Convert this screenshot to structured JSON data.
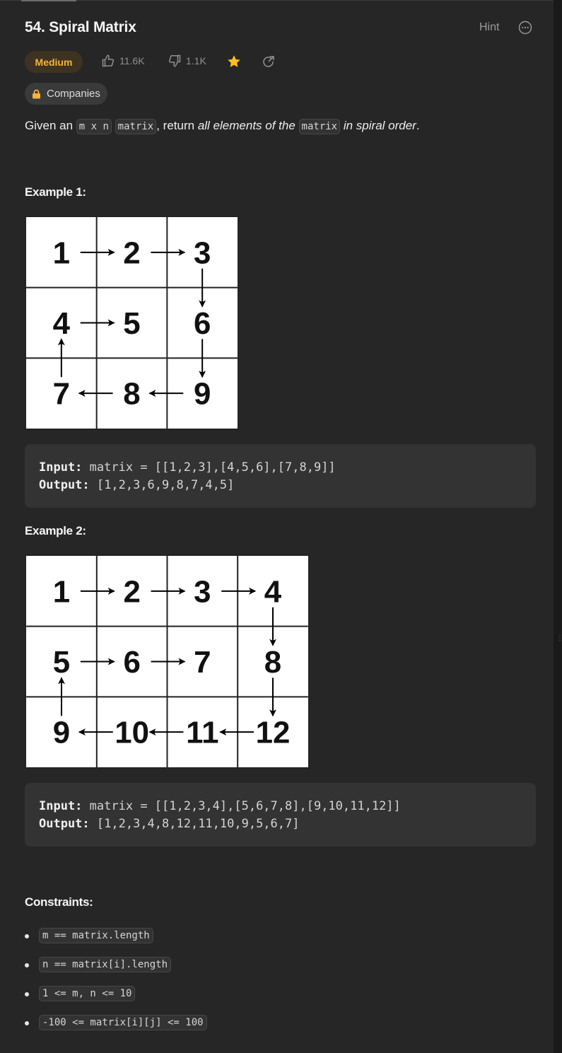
{
  "header": {
    "title": "54. Spiral Matrix",
    "hint_label": "Hint"
  },
  "meta": {
    "difficulty": "Medium",
    "likes": "11.6K",
    "dislikes": "1.1K",
    "companies_label": "Companies",
    "colors": {
      "difficulty": "#f6b33c",
      "star": "#ffc01e"
    }
  },
  "description": {
    "p1": "Given an ",
    "code_mxn": "m x n",
    "code_matrix": "matrix",
    "p2": ", return ",
    "em": "all elements of the",
    "code_matrix2": "matrix",
    "em2": "in spiral order",
    "p3": "."
  },
  "example1": {
    "heading": "Example 1:",
    "grid": [
      [
        "1",
        "2",
        "3"
      ],
      [
        "4",
        "5",
        "6"
      ],
      [
        "7",
        "8",
        "9"
      ]
    ],
    "input_label": "Input:",
    "input_value": "matrix = [[1,2,3],[4,5,6],[7,8,9]]",
    "output_label": "Output:",
    "output_value": "[1,2,3,6,9,8,7,4,5]"
  },
  "example2": {
    "heading": "Example 2:",
    "grid": [
      [
        "1",
        "2",
        "3",
        "4"
      ],
      [
        "5",
        "6",
        "7",
        "8"
      ],
      [
        "9",
        "10",
        "11",
        "12"
      ]
    ],
    "input_label": "Input:",
    "input_value": "matrix = [[1,2,3,4],[5,6,7,8],[9,10,11,12]]",
    "output_label": "Output:",
    "output_value": "[1,2,3,4,8,12,11,10,9,5,6,7]"
  },
  "constraints": {
    "heading": "Constraints:",
    "items": [
      "m == matrix.length",
      "n == matrix[i].length",
      "1 <= m, n <= 10",
      "-100 <= matrix[i][j] <= 100"
    ]
  }
}
